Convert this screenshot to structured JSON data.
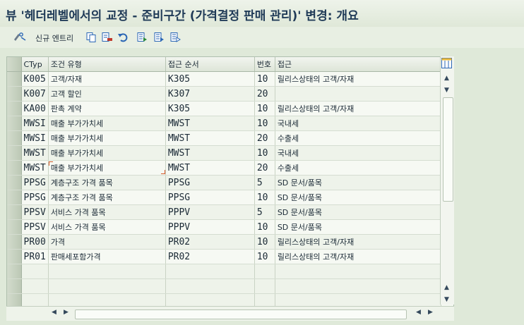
{
  "window": {
    "title": "뷰 '헤더레벨에서의 교정 - 준비구간 (가격결정 판매 관리)' 변경: 개요"
  },
  "toolbar": {
    "new_entries_label": "신규 엔트리"
  },
  "columns": [
    "CTyp",
    "조건 유형",
    "접근 순서",
    "번호",
    "접근"
  ],
  "rows": [
    {
      "ctyp": "K005",
      "type": "고객/자재",
      "seq": "K305",
      "num": "10",
      "access": "릴리스상태의 고객/자재"
    },
    {
      "ctyp": "K007",
      "type": "고객 할인",
      "seq": "K307",
      "num": "20",
      "access": ""
    },
    {
      "ctyp": "KA00",
      "type": "판촉 계약",
      "seq": "K305",
      "num": "10",
      "access": "릴리스상태의 고객/자재"
    },
    {
      "ctyp": "MWSI",
      "type": "매출 부가가치세",
      "seq": "MWST",
      "num": "10",
      "access": "국내세"
    },
    {
      "ctyp": "MWSI",
      "type": "매출 부가가치세",
      "seq": "MWST",
      "num": "20",
      "access": "수출세"
    },
    {
      "ctyp": "MWST",
      "type": "매출 부가가치세",
      "seq": "MWST",
      "num": "10",
      "access": "국내세"
    },
    {
      "ctyp": "MWST",
      "type": "매출 부가가치세",
      "seq": "MWST",
      "num": "20",
      "access": "수출세"
    },
    {
      "ctyp": "PPSG",
      "type": "계층구조 가격 품목",
      "seq": "PPSG",
      "num": "5",
      "access": "SD 문서/품목"
    },
    {
      "ctyp": "PPSG",
      "type": "계층구조 가격 품목",
      "seq": "PPSG",
      "num": "10",
      "access": "SD 문서/품목"
    },
    {
      "ctyp": "PPSV",
      "type": "서비스 가격 품목",
      "seq": "PPPV",
      "num": "5",
      "access": "SD 문서/품목"
    },
    {
      "ctyp": "PPSV",
      "type": "서비스 가격 품목",
      "seq": "PPPV",
      "num": "10",
      "access": "SD 문서/품목"
    },
    {
      "ctyp": "PR00",
      "type": "가격",
      "seq": "PR02",
      "num": "10",
      "access": "릴리스상태의 고객/자재"
    },
    {
      "ctyp": "PR01",
      "type": "판매세포함가격",
      "seq": "PR02",
      "num": "10",
      "access": "릴리스상태의 고객/자재"
    }
  ],
  "empty_rows": 4,
  "colors": {
    "background": "#dfe9d9",
    "title": "#1f3a57",
    "focus": "#d45b2b"
  }
}
